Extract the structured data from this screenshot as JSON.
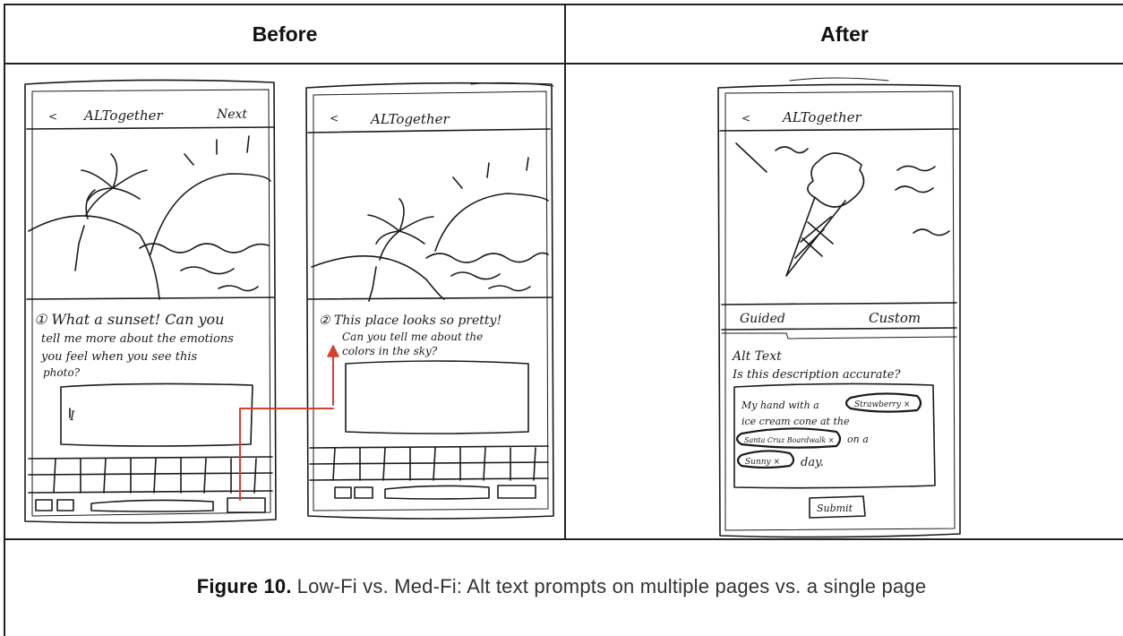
{
  "table": {
    "before_header": "Before",
    "after_header": "After"
  },
  "sketch_before_1": {
    "app_title": "ALTogether",
    "back": "<",
    "next": "Next",
    "prompt_line1": "① What a sunset! Can you",
    "prompt_line2": "tell me more about the emotions",
    "prompt_line3": "you feel when you see this",
    "prompt_line4": "photo?",
    "input_value": "I"
  },
  "sketch_before_2": {
    "app_title": "ALTogether",
    "back": "<",
    "prompt_line1": "② This place looks so pretty!",
    "prompt_line2": "Can you tell me about the",
    "prompt_line3": "colors in the sky?"
  },
  "sketch_after": {
    "app_title": "ALTogether",
    "back": "<",
    "tab_guided": "Guided",
    "tab_custom": "Custom",
    "alt_text_label": "Alt Text",
    "question": "Is this description accurate?",
    "desc_part1": "My hand with a",
    "chip_1": "Strawberry ×",
    "desc_part2": "ice cream cone at the",
    "chip_2": "Santa Cruz Boardwalk ×",
    "desc_part3": "on a",
    "chip_3": "Sunny ×",
    "desc_part4": "day.",
    "submit": "Submit"
  },
  "figure": {
    "label": "Figure 10.",
    "caption": "Low-Fi vs. Med-Fi: Alt text prompts on multiple pages vs. a single page"
  },
  "colors": {
    "border": "#222222",
    "sketch_ink": "#1a1a1a",
    "arrow": "#d9402b"
  }
}
